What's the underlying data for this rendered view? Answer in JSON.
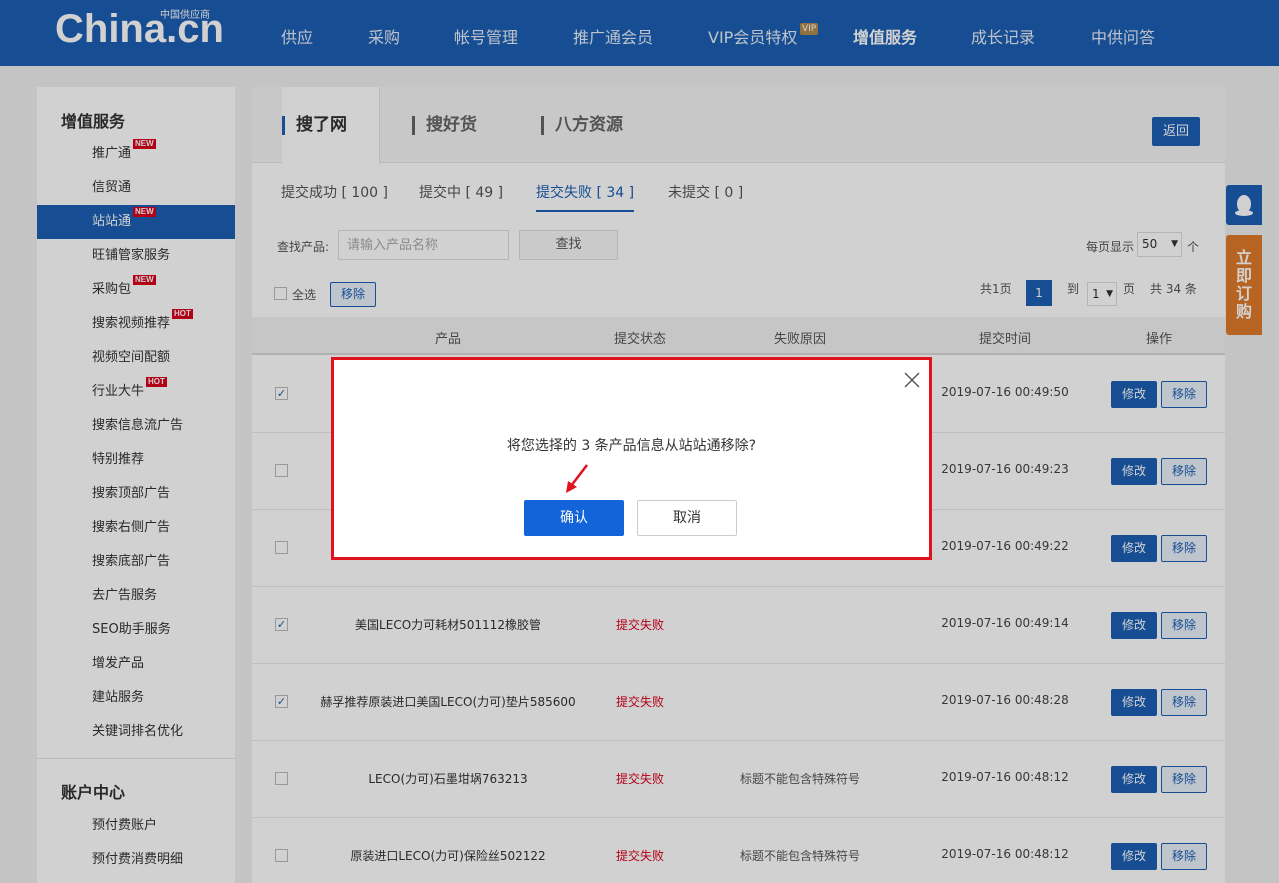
{
  "header": {
    "logo_text": "China.cn",
    "logo_sub": "中国供应商",
    "nav": [
      {
        "label": "供应"
      },
      {
        "label": "采购"
      },
      {
        "label": "帐号管理"
      },
      {
        "label": "推广通会员"
      },
      {
        "label": "VIP会员特权"
      },
      {
        "label": "增值服务"
      },
      {
        "label": "成长记录"
      },
      {
        "label": "中供问答"
      }
    ],
    "vip_badge": "VIP",
    "active_nav": "增值服务"
  },
  "sidebar": {
    "section1_title": "增值服务",
    "items": [
      {
        "label": "推广通",
        "tag": "NEW"
      },
      {
        "label": "信贸通",
        "tag": ""
      },
      {
        "label": "站站通",
        "tag": "NEW"
      },
      {
        "label": "旺铺管家服务",
        "tag": ""
      },
      {
        "label": "采购包",
        "tag": "NEW"
      },
      {
        "label": "搜索视频推荐",
        "tag": "HOT"
      },
      {
        "label": "视频空间配额",
        "tag": ""
      },
      {
        "label": "行业大牛",
        "tag": "HOT"
      },
      {
        "label": "搜索信息流广告",
        "tag": ""
      },
      {
        "label": "特别推荐",
        "tag": ""
      },
      {
        "label": "搜索顶部广告",
        "tag": ""
      },
      {
        "label": "搜索右侧广告",
        "tag": ""
      },
      {
        "label": "搜索底部广告",
        "tag": ""
      },
      {
        "label": "去广告服务",
        "tag": ""
      },
      {
        "label": "SEO助手服务",
        "tag": ""
      },
      {
        "label": "增发产品",
        "tag": ""
      },
      {
        "label": "建站服务",
        "tag": ""
      },
      {
        "label": "关键词排名优化",
        "tag": ""
      }
    ],
    "section2_title": "账户中心",
    "account_items": [
      {
        "label": "预付费账户"
      },
      {
        "label": "预付费消费明细"
      }
    ]
  },
  "main": {
    "source_tabs": [
      "搜了网",
      "搜好货",
      "八方资源"
    ],
    "back_label": "返回",
    "status_tabs": [
      "提交成功 [ 100 ]",
      "提交中 [ 49 ]",
      "提交失败 [ 34 ]",
      "未提交 [ 0 ]"
    ],
    "search_label": "查找产品:",
    "search_placeholder": "请输入产品名称",
    "search_button": "查找",
    "per_page_label": "每页显示",
    "per_page_value": "50",
    "per_page_unit": "个",
    "select_all_label": "全选",
    "remove_label": "移除",
    "pager": {
      "total_pages": "共1页",
      "current_page": "1",
      "goto_label": "到",
      "goto_value": "1",
      "page_unit": "页",
      "total_items": "共 34 条"
    },
    "columns": [
      "产品",
      "提交状态",
      "失败原因",
      "提交时间",
      "操作"
    ],
    "rows": [
      {
        "checked": true,
        "product": "",
        "status": "",
        "reason": "",
        "time": "2019-07-16 00:49:50",
        "edit": "修改",
        "remove": "移除"
      },
      {
        "checked": false,
        "product": "",
        "status": "",
        "reason": "",
        "time": "2019-07-16 00:49:23",
        "edit": "修改",
        "remove": "移除"
      },
      {
        "checked": false,
        "product": "",
        "status": "",
        "reason": "",
        "time": "2019-07-16 00:49:22",
        "edit": "修改",
        "remove": "移除"
      },
      {
        "checked": true,
        "product": "美国LECO力可耗材501112橡胶管",
        "status": "提交失败",
        "reason": "",
        "time": "2019-07-16 00:49:14",
        "edit": "修改",
        "remove": "移除"
      },
      {
        "checked": true,
        "product": "赫孚推荐原装进口美国LECO(力可)垫片585600",
        "status": "提交失败",
        "reason": "",
        "time": "2019-07-16 00:48:28",
        "edit": "修改",
        "remove": "移除"
      },
      {
        "checked": false,
        "product": "LECO(力可)石墨坩埚763213",
        "status": "提交失败",
        "reason": "标题不能包含特殊符号",
        "time": "2019-07-16 00:48:12",
        "edit": "修改",
        "remove": "移除"
      },
      {
        "checked": false,
        "product": "原装进口LECO(力可)保险丝502122",
        "status": "提交失败",
        "reason": "标题不能包含特殊符号",
        "time": "2019-07-16 00:48:12",
        "edit": "修改",
        "remove": "移除"
      }
    ]
  },
  "dialog": {
    "message": "将您选择的 3 条产品信息从站站通移除?",
    "confirm": "确认",
    "cancel": "取消"
  },
  "float": {
    "order_label": "立即订购"
  },
  "colors": {
    "brand_blue": "#1b5fb4",
    "confirm_blue": "#1364d8",
    "status_red": "#d9001b",
    "highlight_red": "#e0121c",
    "order_orange": "#e07b2a"
  }
}
